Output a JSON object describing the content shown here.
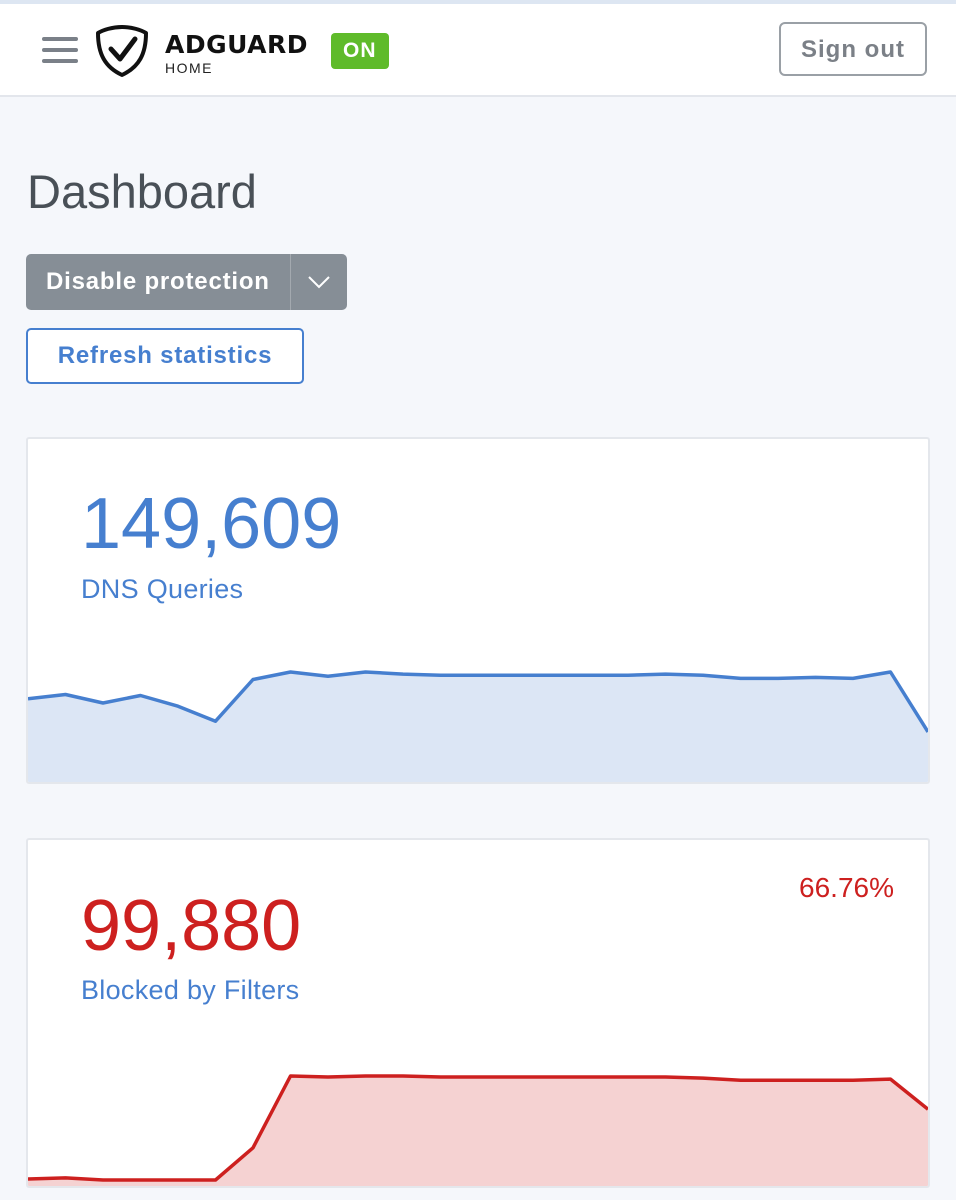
{
  "header": {
    "brand_name": "ADGUARD",
    "brand_sub": "HOME",
    "status": "ON",
    "sign_out": "Sign out"
  },
  "page": {
    "title": "Dashboard",
    "disable_protection": "Disable protection",
    "refresh_statistics": "Refresh statistics"
  },
  "cards": [
    {
      "value": "149,609",
      "label": "DNS Queries",
      "color": "#467fcf",
      "fill": "#dce6f5",
      "series": [
        0.75,
        0.79,
        0.71,
        0.78,
        0.68,
        0.54,
        0.93,
        1.0,
        0.96,
        1.0,
        0.98,
        0.97,
        0.97,
        0.97,
        0.97,
        0.97,
        0.97,
        0.98,
        0.97,
        0.94,
        0.94,
        0.95,
        0.94,
        1.0,
        0.44
      ]
    },
    {
      "value": "99,880",
      "label": "Blocked by Filters",
      "percent": "66.76%",
      "color": "#cd201f",
      "fill": "#f5d2d2",
      "series": [
        0.01,
        0.02,
        0.0,
        0.0,
        0.0,
        0.0,
        0.31,
        1.0,
        0.99,
        1.0,
        1.0,
        0.99,
        0.99,
        0.99,
        0.99,
        0.99,
        0.99,
        0.99,
        0.98,
        0.96,
        0.96,
        0.96,
        0.96,
        0.97,
        0.68
      ]
    }
  ]
}
